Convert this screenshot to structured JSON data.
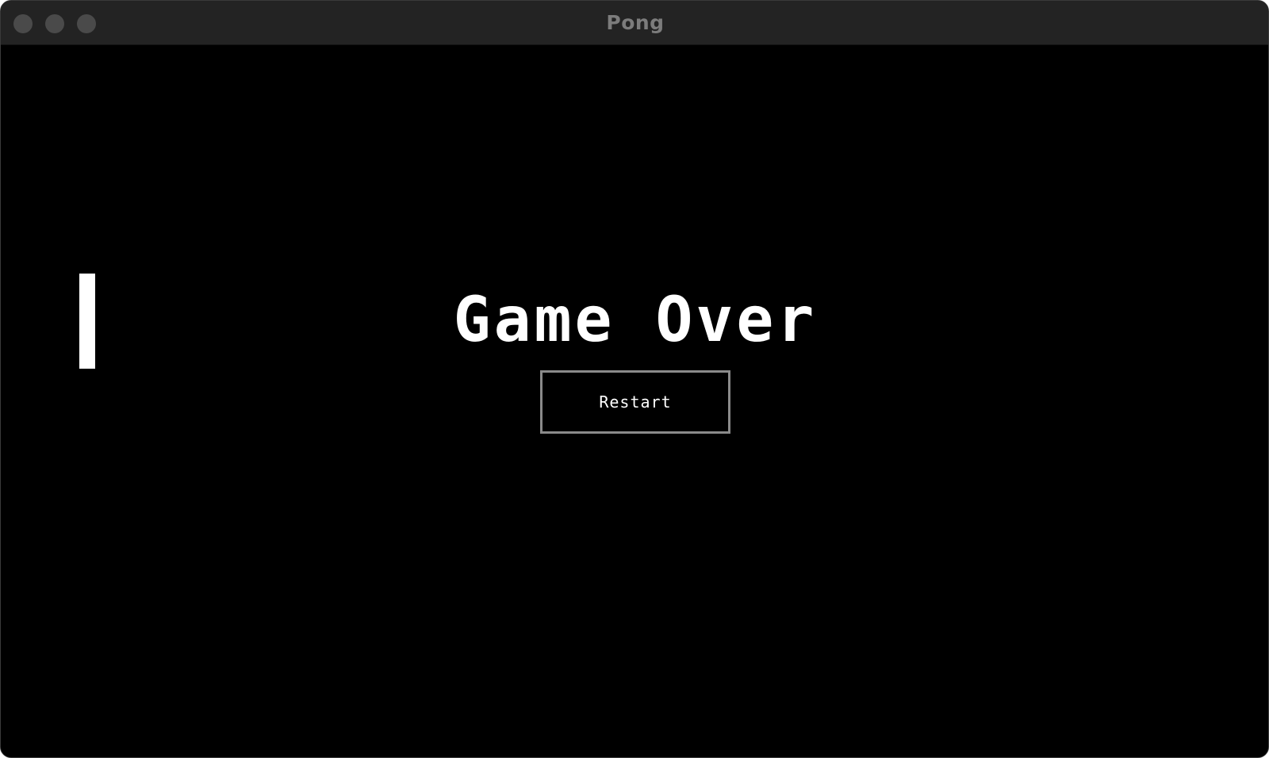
{
  "window": {
    "title": "Pong"
  },
  "game": {
    "status_text": "Game Over",
    "restart_label": "Restart"
  },
  "colors": {
    "background": "#000000",
    "foreground": "#ffffff",
    "button_border": "#8a8a8a",
    "titlebar": "#232323",
    "title_text": "#7c7c7c"
  }
}
